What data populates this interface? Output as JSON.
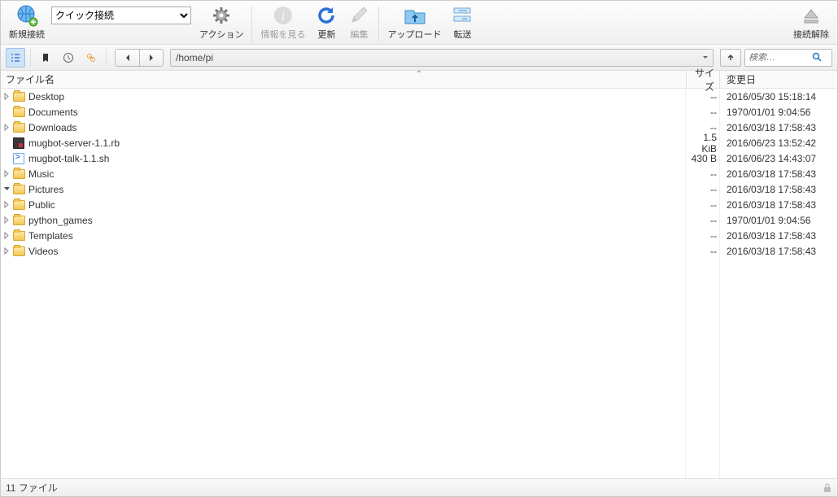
{
  "toolbar": {
    "new_connection": "新規接続",
    "quick_connect_placeholder": "クイック接続",
    "action": "アクション",
    "info": "情報を見る",
    "refresh": "更新",
    "edit": "編集",
    "upload": "アップロード",
    "transfer": "転送",
    "disconnect": "接続解除"
  },
  "nav": {
    "path": "/home/pi",
    "search_placeholder": "検索…"
  },
  "columns": {
    "name": "ファイル名",
    "size": "サイズ",
    "modified": "変更日"
  },
  "files": [
    {
      "name": "Desktop",
      "type": "folder",
      "expandable": true,
      "expanded": false,
      "size": "--",
      "modified": "2016/05/30 15:18:14"
    },
    {
      "name": "Documents",
      "type": "folder",
      "expandable": false,
      "expanded": false,
      "size": "--",
      "modified": "1970/01/01 9:04:56"
    },
    {
      "name": "Downloads",
      "type": "folder",
      "expandable": true,
      "expanded": false,
      "size": "--",
      "modified": "2016/03/18 17:58:43"
    },
    {
      "name": "mugbot-server-1.1.rb",
      "type": "rb",
      "expandable": false,
      "expanded": false,
      "size": "1.5 KiB",
      "modified": "2016/06/23 13:52:42"
    },
    {
      "name": "mugbot-talk-1.1.sh",
      "type": "sh",
      "expandable": false,
      "expanded": false,
      "size": "430 B",
      "modified": "2016/06/23 14:43:07"
    },
    {
      "name": "Music",
      "type": "folder",
      "expandable": true,
      "expanded": false,
      "size": "--",
      "modified": "2016/03/18 17:58:43"
    },
    {
      "name": "Pictures",
      "type": "folder",
      "expandable": true,
      "expanded": true,
      "size": "--",
      "modified": "2016/03/18 17:58:43"
    },
    {
      "name": "Public",
      "type": "folder",
      "expandable": true,
      "expanded": false,
      "size": "--",
      "modified": "2016/03/18 17:58:43"
    },
    {
      "name": "python_games",
      "type": "folder",
      "expandable": true,
      "expanded": false,
      "size": "--",
      "modified": "1970/01/01 9:04:56"
    },
    {
      "name": "Templates",
      "type": "folder",
      "expandable": true,
      "expanded": false,
      "size": "--",
      "modified": "2016/03/18 17:58:43"
    },
    {
      "name": "Videos",
      "type": "folder",
      "expandable": true,
      "expanded": false,
      "size": "--",
      "modified": "2016/03/18 17:58:43"
    }
  ],
  "status": {
    "text": "11 ファイル"
  }
}
